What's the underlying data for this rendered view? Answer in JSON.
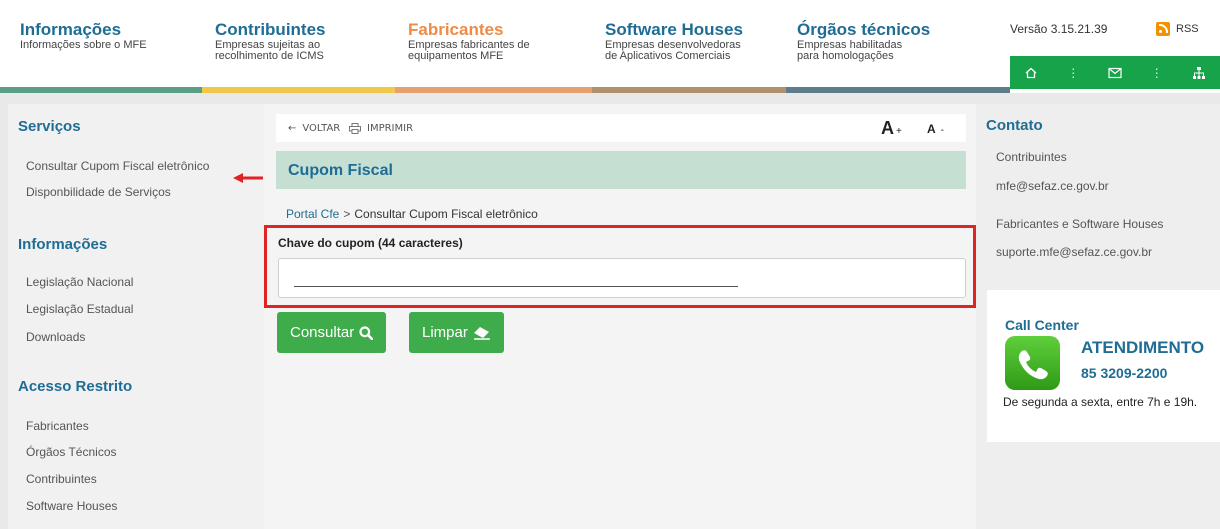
{
  "nav": [
    {
      "title": "Informações",
      "desc": [
        "Informações sobre o MFE"
      ],
      "color": "#1f6d94",
      "bar": "#5a9e86"
    },
    {
      "title": "Contribuintes",
      "desc": [
        "Empresas sujeitas ao",
        "recolhimento de ICMS"
      ],
      "color": "#1f6d94",
      "bar": "#f2c84b"
    },
    {
      "title": "Fabricantes",
      "desc": [
        "Empresas fabricantes de",
        "equipamentos MFE"
      ],
      "color": "#ef8b47",
      "bar": "#e8a070"
    },
    {
      "title": "Software Houses",
      "desc": [
        "Empresas desenvolvedoras",
        "de Aplicativos Comerciais"
      ],
      "color": "#1f6d94",
      "bar": "#b0916b"
    },
    {
      "title": "Órgãos técnicos",
      "desc": [
        "Empresas habilitadas",
        "para homologações"
      ],
      "color": "#1f6d94",
      "bar": "#5c7e8c"
    }
  ],
  "header": {
    "version": "Versão 3.15.21.39",
    "rss": "RSS"
  },
  "sidebar": {
    "servicos": {
      "title": "Serviços",
      "items": [
        "Consultar Cupom Fiscal eletrônico",
        "Disponbilidade de Serviços"
      ]
    },
    "informacoes": {
      "title": "Informações",
      "items": [
        "Legislação Nacional",
        "Legislação Estadual",
        "Downloads"
      ]
    },
    "acesso": {
      "title": "Acesso Restrito",
      "items": [
        "Fabricantes",
        "Órgãos Técnicos",
        "Contribuintes",
        "Software Houses"
      ]
    }
  },
  "toolbar": {
    "back": "VOLTAR",
    "print": "IMPRIMIR",
    "font_up": "A",
    "font_up_sign": "+",
    "font_down": "A",
    "font_down_sign": "-"
  },
  "main": {
    "title": "Cupom Fiscal",
    "breadcrumb": {
      "root": "Portal Cfe",
      "sep": ">",
      "current": "Consultar Cupom Fiscal eletrônico"
    },
    "field_label": "Chave do cupom (44 caracteres)",
    "field_value": "",
    "consult_label": "Consultar",
    "clear_label": "Limpar"
  },
  "contact": {
    "title": "Contato",
    "contrib_label": "Contribuintes",
    "contrib_email": "mfe@sefaz.ce.gov.br",
    "fab_label": "Fabricantes e Software Houses",
    "fab_email": "suporte.mfe@sefaz.ce.gov.br"
  },
  "callcenter": {
    "title": "Call Center",
    "label": "ATENDIMENTO",
    "number": "85 3209-2200",
    "hours": "De segunda a sexta, entre 7h e 19h."
  },
  "colors": {
    "accent": "#1f6d94",
    "button": "#3eac4a",
    "highlight": "#e02424",
    "util_bar": "#16a34a"
  }
}
